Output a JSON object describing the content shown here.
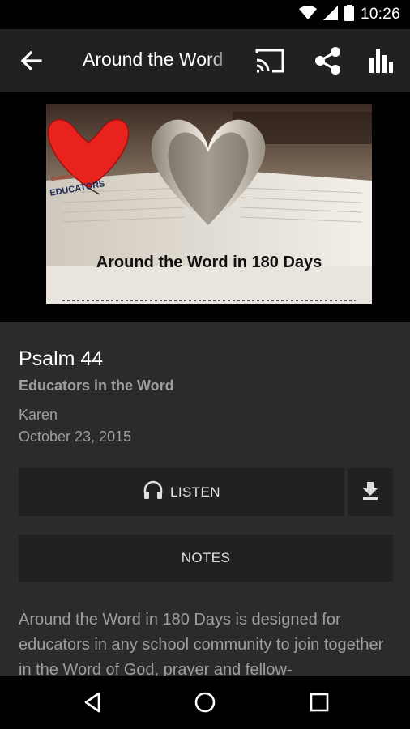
{
  "status_bar": {
    "time": "10:26"
  },
  "toolbar": {
    "title": "Around the Word"
  },
  "artwork": {
    "caption": "Around the Word in 180 Days",
    "badge_small": "Christian",
    "badge_text": "EDUCATORS"
  },
  "episode": {
    "title": "Psalm 44",
    "podcast": "Educators in the Word",
    "author": "Karen",
    "date": "October 23, 2015",
    "description": "Around the Word in 180 Days is designed for educators in any school community to join together in the Word of God, prayer and fellow-"
  },
  "actions": {
    "listen_label": "LISTEN",
    "notes_label": "NOTES"
  },
  "colors": {
    "background": "#2b2b2b",
    "toolbar": "#212121",
    "button": "#212121",
    "secondary_text": "#9e9e9e",
    "heart": "#e8221c"
  }
}
